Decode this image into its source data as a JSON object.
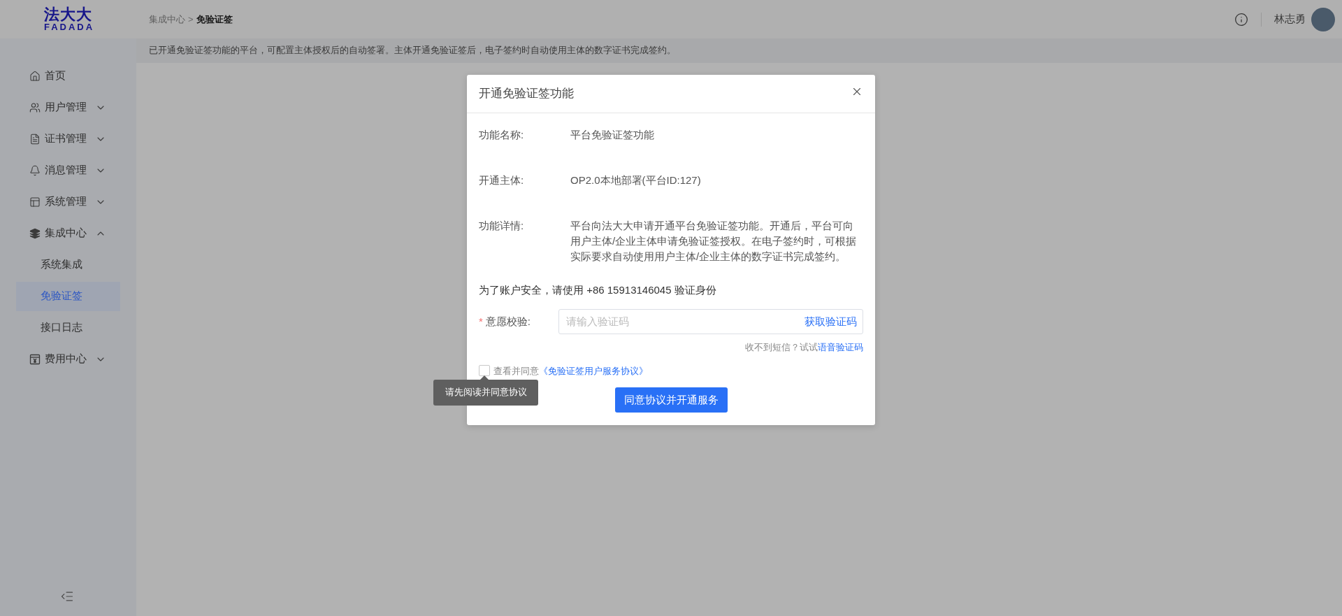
{
  "header": {
    "logo": {
      "mark": "法大大",
      "wordmark": "FADADA"
    },
    "breadcrumb": [
      {
        "label": "集成中心",
        "current": false
      },
      {
        "label": "免验证签",
        "current": true
      }
    ],
    "separator": ">",
    "user_name": "林志勇"
  },
  "notice": "已开通免验证签功能的平台，可配置主体授权后的自动签署。主体开通免验证签后，电子签约时自动使用主体的数字证书完成签约。",
  "sidebar": {
    "items": [
      {
        "kind": "home",
        "label": "首页",
        "selected": false
      },
      {
        "kind": "users",
        "label": "用户管理",
        "expanded": false,
        "selected": false
      },
      {
        "kind": "document",
        "label": "证书管理",
        "expanded": false,
        "selected": false
      },
      {
        "kind": "bell",
        "label": "消息管理",
        "expanded": false,
        "selected": false
      },
      {
        "kind": "layout",
        "label": "系统管理",
        "expanded": false,
        "selected": false
      },
      {
        "kind": "layers",
        "label": "集成中心",
        "expanded": true,
        "selected": false,
        "children": [
          {
            "label": "系统集成",
            "selected": false
          },
          {
            "label": "免验证签",
            "selected": true
          },
          {
            "label": "接口日志",
            "selected": false
          }
        ]
      },
      {
        "kind": "fee",
        "label": "费用中心",
        "expanded": false,
        "selected": false
      }
    ]
  },
  "modal": {
    "title": "开通免验证签功能",
    "fields": [
      {
        "label": "功能名称:",
        "value": "平台免验证签功能"
      },
      {
        "label": "开通主体:",
        "value": "OP2.0本地部署(平台ID:127)"
      },
      {
        "label": "功能详情:",
        "value": "平台向法大大申请开通平台免验证签功能。开通后，平台可向用户主体/企业主体申请免验证签授权。在电子签约时，可根据实际要求自动使用用户主体/企业主体的数字证书完成签约。"
      }
    ],
    "verify_prompt": "为了账户安全，请使用 +86 15913146045 验证身份",
    "verify_field": {
      "required_mark": "*",
      "label": "意愿校验:",
      "placeholder": "请输入验证码",
      "action": "获取验证码"
    },
    "sms_hint": {
      "text": "收不到短信？试试",
      "link": "语音验证码"
    },
    "agreement": {
      "checked": false,
      "prefix": "查看并同意",
      "link": "《免验证签用户服务协议》"
    },
    "tooltip": "请先阅读并同意协议",
    "submit": "同意协议并开通服务"
  }
}
